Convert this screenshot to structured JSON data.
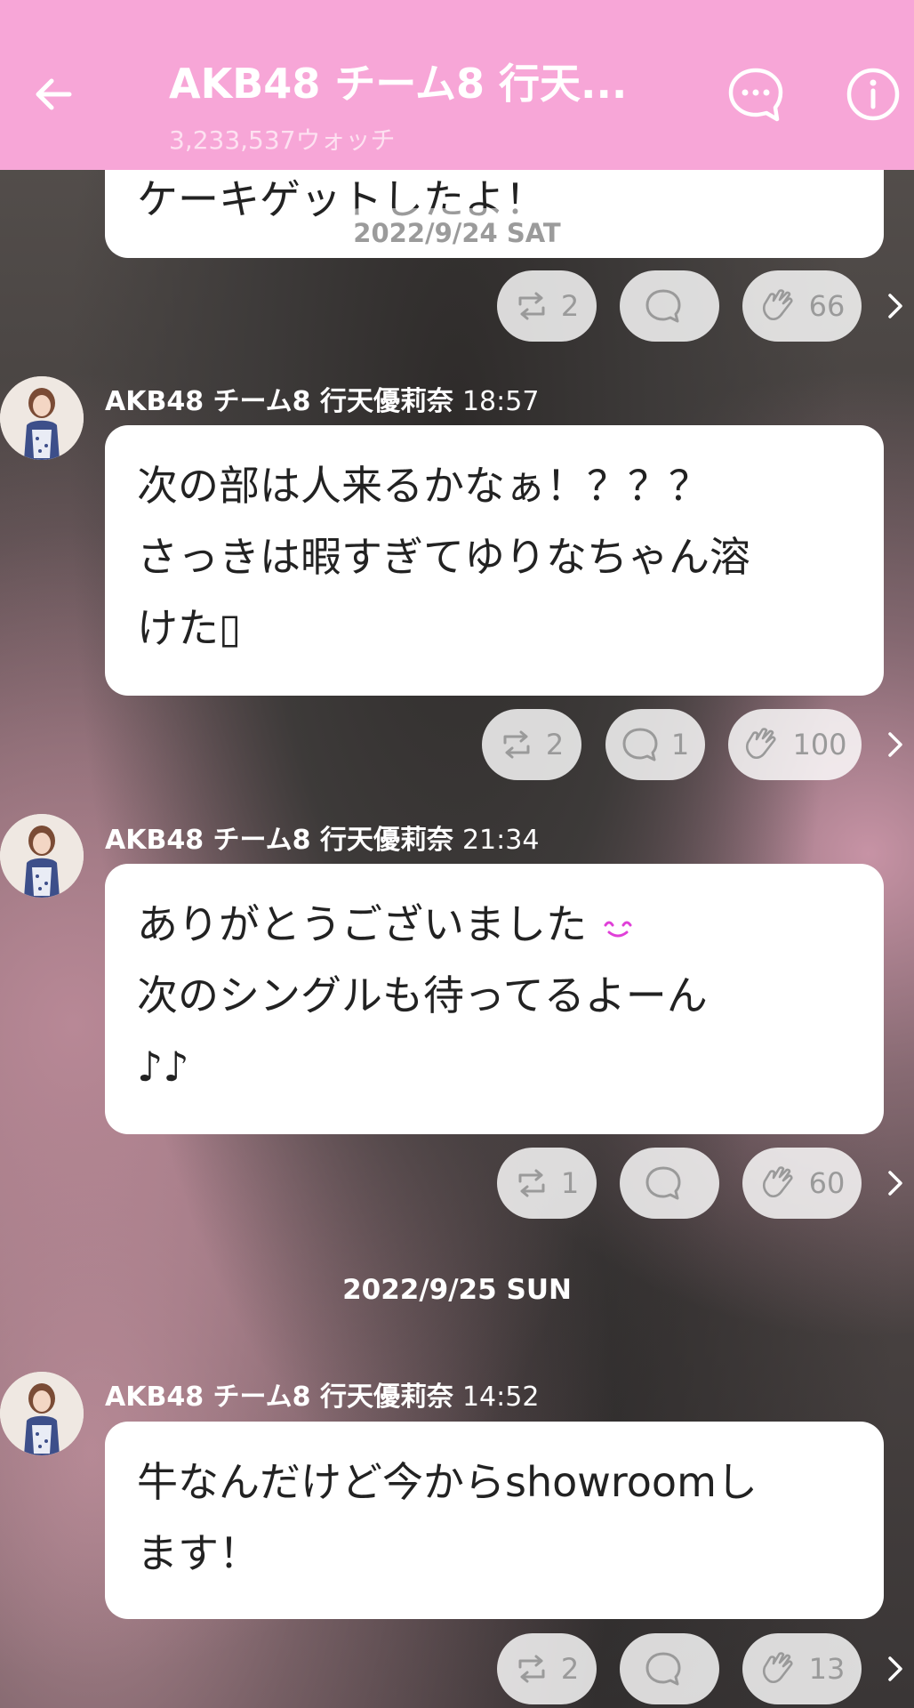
{
  "header": {
    "title": "AKB48 チーム8 行天...",
    "subtitle": "3,233,537ウォッチ",
    "back_icon": "arrow-left-icon",
    "chat_icon": "chat-bubble-icon",
    "info_icon": "info-icon",
    "color": "#f7a6d7"
  },
  "top_message": {
    "text": "ケーキゲットしたよ！",
    "date_chip": "2022/9/24 SAT",
    "reactions": {
      "repost": "2",
      "comment": "",
      "clap": "66"
    }
  },
  "messages": [
    {
      "sender": "AKB48 チーム8 行天優莉奈",
      "time": "18:57",
      "lines": [
        "次の部は人来るかなぁ！？？？",
        "さっきは暇すぎてゆりなちゃん溶",
        "けた▯"
      ],
      "reactions": {
        "repost": "2",
        "comment": "1",
        "clap": "100"
      }
    },
    {
      "sender": "AKB48 チーム8 行天優莉奈",
      "time": "21:34",
      "lines": [
        "ありがとうございました",
        "次のシングルも待ってるよーん",
        "♪♪"
      ],
      "emoji": "smile-emoji",
      "reactions": {
        "repost": "1",
        "comment": "",
        "clap": "60"
      }
    },
    {
      "date_separator": "2022/9/25 SUN",
      "sender": "AKB48 チーム8 行天優莉奈",
      "time": "14:52",
      "lines": [
        "牛なんだけど今からshowroomし",
        "ます！"
      ],
      "reactions": {
        "repost": "2",
        "comment": "",
        "clap": "13"
      }
    }
  ]
}
